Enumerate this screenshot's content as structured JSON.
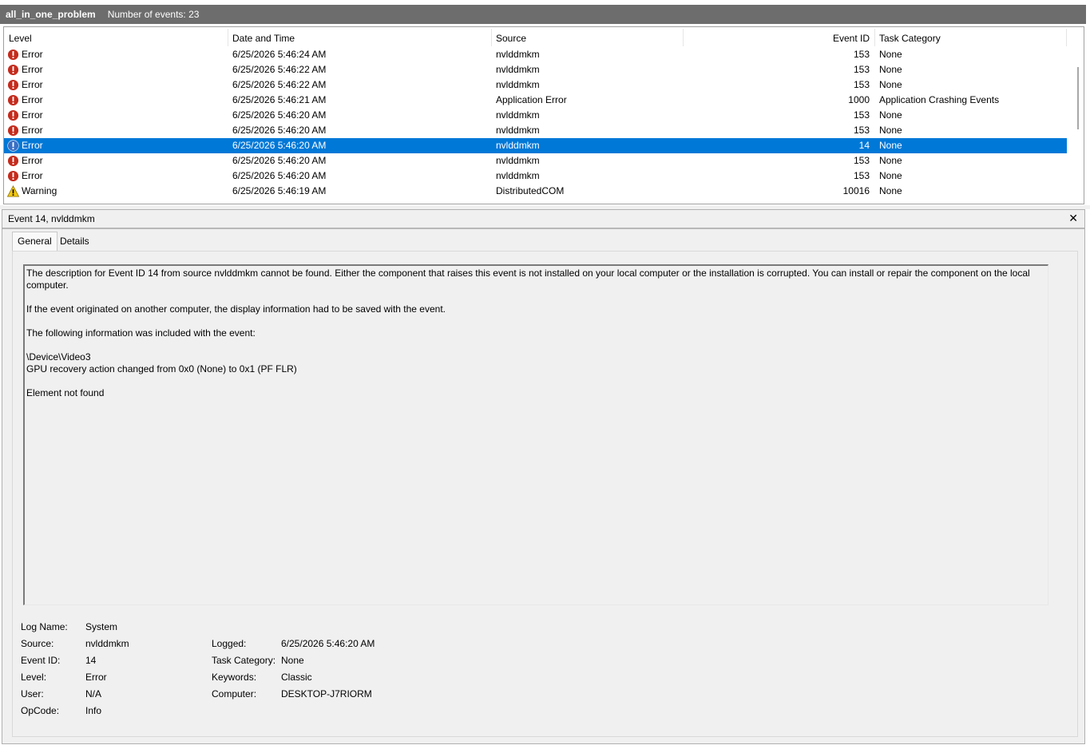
{
  "header": {
    "log_name": "all_in_one_problem",
    "count_text": "Number of events: 23"
  },
  "columns": {
    "level": "Level",
    "date": "Date and Time",
    "source": "Source",
    "event_id": "Event ID",
    "category": "Task Category"
  },
  "events": [
    {
      "icon": "error-icon",
      "level": "Error",
      "date": "6/25/2026 5:46:24 AM",
      "source": "nvlddmkm",
      "event_id": "153",
      "category": "None"
    },
    {
      "icon": "error-icon",
      "level": "Error",
      "date": "6/25/2026 5:46:22 AM",
      "source": "nvlddmkm",
      "event_id": "153",
      "category": "None"
    },
    {
      "icon": "error-icon",
      "level": "Error",
      "date": "6/25/2026 5:46:22 AM",
      "source": "nvlddmkm",
      "event_id": "153",
      "category": "None"
    },
    {
      "icon": "error-icon",
      "level": "Error",
      "date": "6/25/2026 5:46:21 AM",
      "source": "Application Error",
      "event_id": "1000",
      "category": "Application Crashing Events"
    },
    {
      "icon": "error-icon",
      "level": "Error",
      "date": "6/25/2026 5:46:20 AM",
      "source": "nvlddmkm",
      "event_id": "153",
      "category": "None"
    },
    {
      "icon": "error-icon",
      "level": "Error",
      "date": "6/25/2026 5:46:20 AM",
      "source": "nvlddmkm",
      "event_id": "153",
      "category": "None"
    },
    {
      "icon": "error-icon",
      "level": "Error",
      "date": "6/25/2026 5:46:20 AM",
      "source": "nvlddmkm",
      "event_id": "14",
      "category": "None",
      "selected": true
    },
    {
      "icon": "error-icon",
      "level": "Error",
      "date": "6/25/2026 5:46:20 AM",
      "source": "nvlddmkm",
      "event_id": "153",
      "category": "None"
    },
    {
      "icon": "error-icon",
      "level": "Error",
      "date": "6/25/2026 5:46:20 AM",
      "source": "nvlddmkm",
      "event_id": "153",
      "category": "None"
    },
    {
      "icon": "warning-icon",
      "level": "Warning",
      "date": "6/25/2026 5:46:19 AM",
      "source": "DistributedCOM",
      "event_id": "10016",
      "category": "None"
    }
  ],
  "detail": {
    "title": "Event 14, nvlddmkm",
    "close_label": "✕",
    "tabs": {
      "general": "General",
      "details": "Details"
    },
    "description": "The description for Event ID 14 from source nvlddmkm cannot be found. Either the component that raises this event is not installed on your local computer or the installation is corrupted. You can install or repair the component on the local computer.\n\nIf the event originated on another computer, the display information had to be saved with the event.\n\nThe following information was included with the event:\n\n\\Device\\Video3\nGPU recovery action changed from 0x0 (None) to 0x1 (PF FLR)\n\nElement not found",
    "props": {
      "log_name_label": "Log Name:",
      "log_name": "System",
      "source_label": "Source:",
      "source": "nvlddmkm",
      "event_id_label": "Event ID:",
      "event_id": "14",
      "level_label": "Level:",
      "level": "Error",
      "user_label": "User:",
      "user": "N/A",
      "opcode_label": "OpCode:",
      "opcode": "Info",
      "logged_label": "Logged:",
      "logged": "6/25/2026 5:46:20 AM",
      "task_category_label": "Task Category:",
      "task_category": "None",
      "keywords_label": "Keywords:",
      "keywords": "Classic",
      "computer_label": "Computer:",
      "computer": "DESKTOP-J7RIORM"
    }
  },
  "colors": {
    "selection": "#0078d7",
    "error": "#c42b1c",
    "warning": "#f2c811"
  }
}
